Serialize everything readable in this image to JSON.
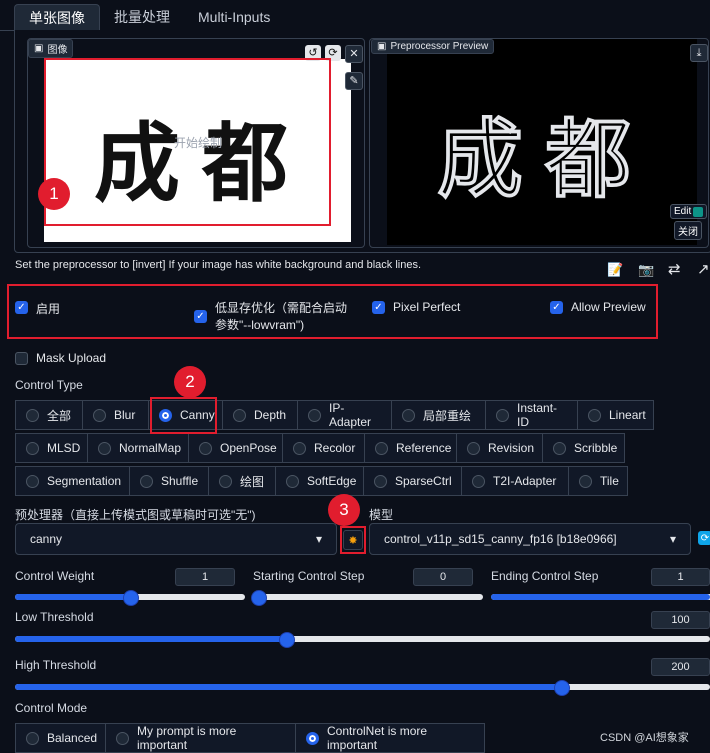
{
  "tabs": [
    {
      "label": "单张图像"
    },
    {
      "label": "批量处理"
    },
    {
      "label": "Multi-Inputs"
    }
  ],
  "image_panel": {
    "label": "图像",
    "canvas_text": "成都",
    "placeholder": "开始绘制"
  },
  "preview_panel": {
    "label": "Preprocessor Preview",
    "canvas_text": "成都",
    "edit_label": "Edit",
    "close_label": "关闭"
  },
  "info_text": "Set the preprocessor to [invert] If your image has white background and black lines.",
  "options": {
    "enable": "启用",
    "low_vram": "低显存优化（需配合启动参数\"--lowvram\")",
    "pixel_perfect": "Pixel Perfect",
    "allow_preview": "Allow Preview",
    "mask_upload": "Mask Upload"
  },
  "control_type": {
    "title": "Control Type",
    "rows": [
      [
        "全部",
        "Blur",
        "Canny",
        "Depth",
        "IP-Adapter",
        "局部重绘",
        "Instant-ID",
        "Lineart"
      ],
      [
        "MLSD",
        "NormalMap",
        "OpenPose",
        "Recolor",
        "Reference",
        "Revision",
        "Scribble"
      ],
      [
        "Segmentation",
        "Shuffle",
        "绘图",
        "SoftEdge",
        "SparseCtrl",
        "T2I-Adapter",
        "Tile"
      ]
    ],
    "selected": "Canny"
  },
  "preprocessor": {
    "label": "预处理器（直接上传模式图或草稿时可选\"无\")",
    "value": "canny"
  },
  "model": {
    "label": "模型",
    "value": "control_v11p_sd15_canny_fp16 [b18e0966]"
  },
  "sliders": {
    "control_weight": {
      "label": "Control Weight",
      "value": "1",
      "fraction": 0.5
    },
    "starting_step": {
      "label": "Starting Control Step",
      "value": "0",
      "fraction": 0
    },
    "ending_step": {
      "label": "Ending Control Step",
      "value": "1",
      "fraction": 1
    },
    "low_threshold": {
      "label": "Low Threshold",
      "value": "100",
      "fraction": 0.39
    },
    "high_threshold": {
      "label": "High Threshold",
      "value": "200",
      "fraction": 0.785
    }
  },
  "control_mode": {
    "title": "Control Mode",
    "options": [
      "Balanced",
      "My prompt is more important",
      "ControlNet is more important"
    ],
    "selected": "ControlNet is more important"
  },
  "annotations": [
    "1",
    "2",
    "3"
  ],
  "watermark": "CSDN @AI想象家",
  "colors": {
    "accent": "#2563eb",
    "highlight": "#e11d2e",
    "background": "#0b0f19"
  }
}
